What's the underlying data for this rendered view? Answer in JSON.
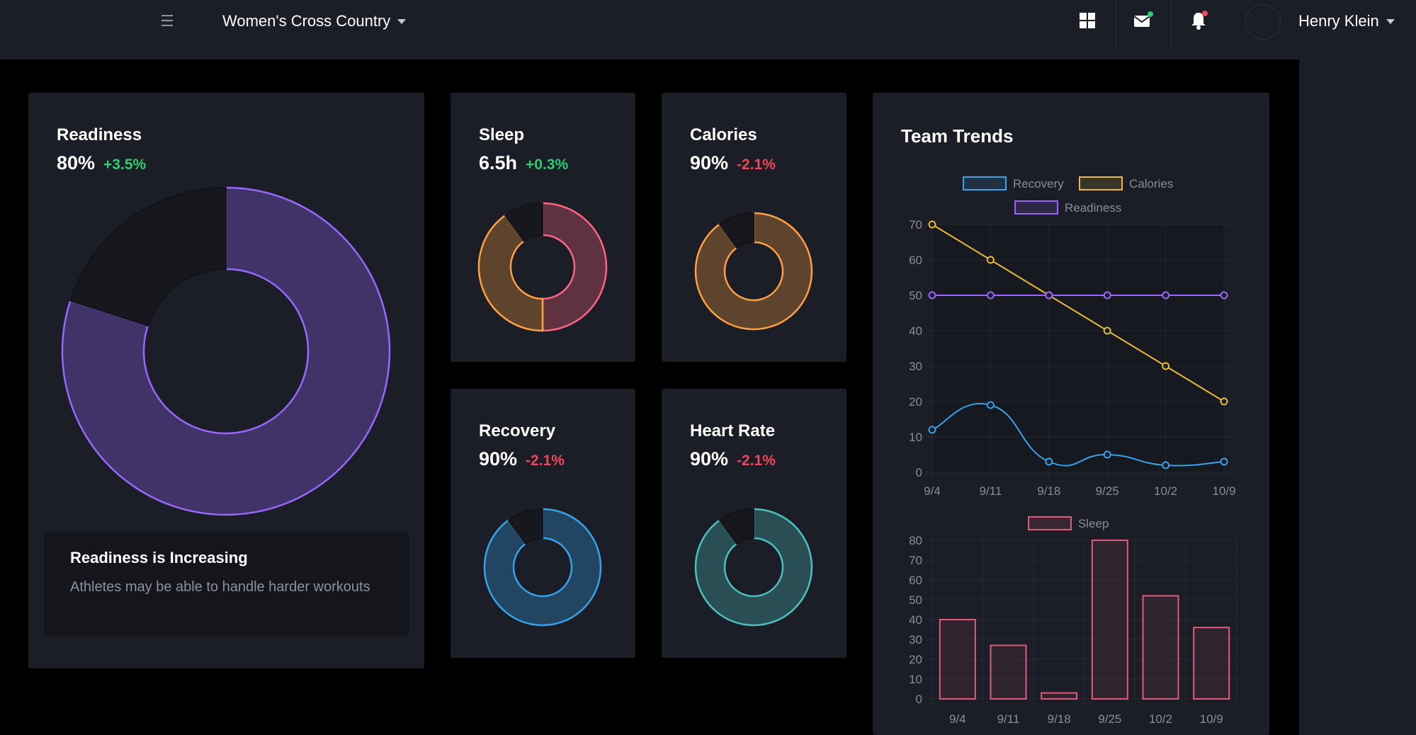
{
  "header": {
    "team": "Women's Cross Country",
    "user": "Henry Klein",
    "icons": [
      "grid-icon",
      "mail-icon",
      "bell-icon",
      "menu-icon"
    ],
    "colors": {
      "mail_badge": "#2ecc71",
      "bell_badge": "#f0455a"
    }
  },
  "cards": {
    "readiness": {
      "title": "Readiness",
      "value": "80%",
      "delta": "+3.5%",
      "percent": 0.8,
      "color": "#9966ff"
    },
    "sleep": {
      "title": "Sleep",
      "value": "6.5h",
      "delta": "+0.3%",
      "segments": [
        0.5,
        0.4
      ],
      "colors": [
        "#ff6384",
        "#ff9f40"
      ]
    },
    "calories": {
      "title": "Calories",
      "value": "90%",
      "delta": "-2.1%",
      "percent": 0.9,
      "color": "#ff9f40"
    },
    "recovery": {
      "title": "Recovery",
      "value": "90%",
      "delta": "-2.1%",
      "percent": 0.9,
      "color": "#36a2eb"
    },
    "heart_rate": {
      "title": "Heart Rate",
      "value": "90%",
      "delta": "-2.1%",
      "percent": 0.9,
      "color": "#4bc0c0"
    }
  },
  "note": {
    "title": "Readiness is Increasing",
    "text": "Athletes may be able to handle harder workouts"
  },
  "trends": {
    "title": "Team Trends"
  },
  "chart_data": [
    {
      "type": "line",
      "x": [
        "9/4",
        "9/11",
        "9/18",
        "9/25",
        "10/2",
        "10/9"
      ],
      "ylim": [
        0,
        70
      ],
      "yticks": [
        0,
        10,
        20,
        30,
        40,
        50,
        60,
        70
      ],
      "grid": true,
      "legend": "top",
      "series": [
        {
          "name": "Recovery",
          "values": [
            12,
            19,
            3,
            5,
            2,
            3
          ],
          "color": "#36a2eb",
          "smooth": true
        },
        {
          "name": "Calories",
          "values": [
            70,
            60,
            50,
            40,
            30,
            20
          ],
          "color": "#e8b93a"
        },
        {
          "name": "Readiness",
          "values": [
            50,
            50,
            50,
            50,
            50,
            50
          ],
          "color": "#9966ff"
        }
      ]
    },
    {
      "type": "bar",
      "categories": [
        "9/4",
        "9/11",
        "9/18",
        "9/25",
        "10/2",
        "10/9"
      ],
      "ylim": [
        0,
        80
      ],
      "yticks": [
        0,
        10,
        20,
        30,
        40,
        50,
        60,
        70,
        80
      ],
      "grid": true,
      "legend": "top",
      "series": [
        {
          "name": "Sleep",
          "values": [
            40,
            27,
            3,
            80,
            52,
            36
          ],
          "color": "#e05b7a"
        }
      ]
    }
  ]
}
